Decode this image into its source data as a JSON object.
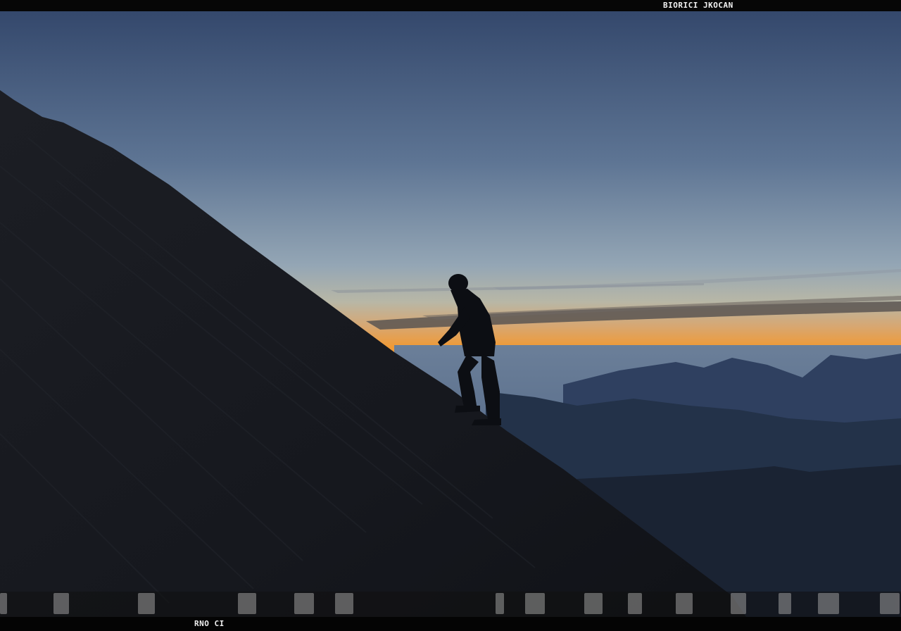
{
  "film": {
    "top_label": "BIORICI JKOCAN",
    "bottom_label": "RNO CI"
  },
  "scene": {
    "colors": {
      "sky_top": "#3d5275",
      "sky_mid": "#8ea1b4",
      "horizon_glow": "#f39a2c",
      "haze": "#4f6686",
      "far_ridge": "#2c3c57",
      "near_ridge": "#1d2839",
      "slope": "#15171d",
      "silhouette": "#0d0f14"
    }
  }
}
